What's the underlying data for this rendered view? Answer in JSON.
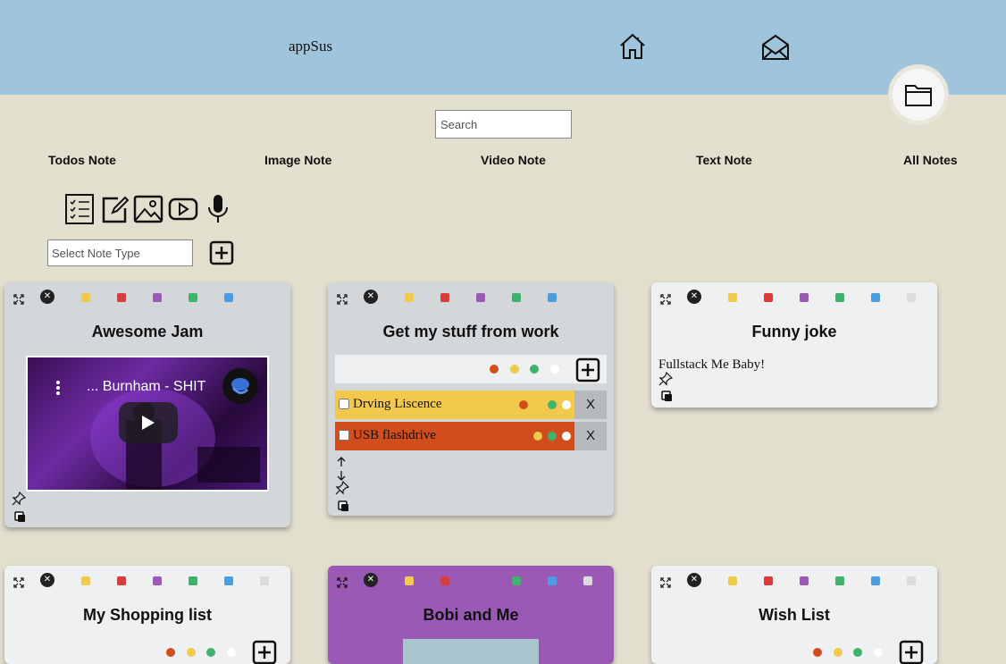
{
  "header": {
    "logo": "appSus",
    "nav": [
      "home-icon",
      "mail-icon",
      "folder-icon"
    ],
    "background": "#9fc4dc"
  },
  "search": {
    "placeholder": "Search"
  },
  "filters": [
    "Todos Note",
    "Image Note",
    "Video Note",
    "Text Note",
    "All Notes"
  ],
  "note_types": [
    "todo-list-icon",
    "text-note-icon",
    "image-note-icon",
    "video-note-icon",
    "microphone-icon"
  ],
  "select_type": {
    "placeholder": "Select Note Type"
  },
  "palette": {
    "orange": "#d24d1c",
    "yellow": "#f2c94c",
    "red": "#dc3b3b",
    "purple": "#9b59b6",
    "green": "#3fb36b",
    "blue": "#4a9de0",
    "light": "#dcdcdc",
    "white": "#ffffff"
  },
  "notes": [
    {
      "title": "Awesome Jam",
      "type": "video",
      "video_title": "... Burnham - SHIT",
      "background": "#d4d7d9"
    },
    {
      "title": "Get my stuff from work",
      "type": "todos",
      "background": "#d4d7d9",
      "todos": [
        {
          "text": "Drving Liscence",
          "color": "#f2c94c",
          "done": false
        },
        {
          "text": "USB flashdrive",
          "color": "#d24d1c",
          "done": false
        }
      ],
      "remove_label": "X"
    },
    {
      "title": "Funny joke",
      "type": "text",
      "text": "Fullstack Me Baby!",
      "background": "#eef0f1"
    },
    {
      "title": "My Shopping list",
      "type": "todos",
      "background": "#eef0f1"
    },
    {
      "title": "Bobi and Me",
      "type": "image",
      "background": "#9b59b6"
    },
    {
      "title": "Wish List",
      "type": "todos",
      "background": "#eef0f1"
    }
  ]
}
